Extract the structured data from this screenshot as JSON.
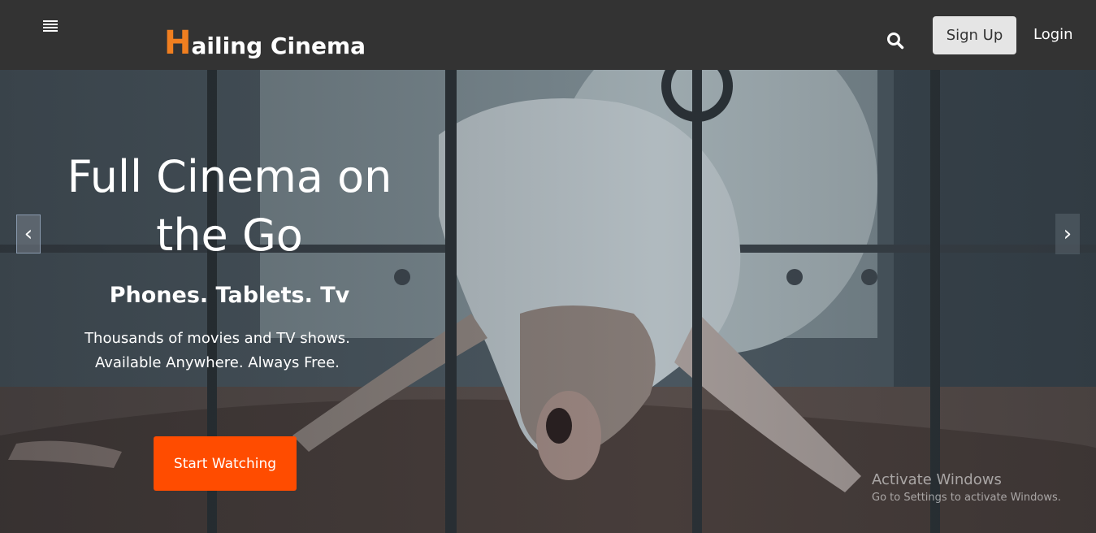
{
  "header": {
    "brand_initial": "H",
    "brand_rest": "ailing Cinema",
    "brand_accent_color": "#f07f20",
    "menu_icon": "hamburger-menu-icon",
    "search_icon": "search-icon",
    "signup_label": "Sign Up",
    "login_label": "Login"
  },
  "hero": {
    "title": "Full Cinema on the Go",
    "subtitle": "Phones. Tablets. Tv",
    "description_line1": "Thousands of movies and TV shows.",
    "description_line2": "Available Anywhere. Always Free.",
    "cta_label": "Start Watching",
    "cta_color": "#ff4c00",
    "prev_arrow": "‹",
    "next_arrow": "›"
  },
  "watermark": {
    "title": "Activate Windows",
    "subtitle": "Go to Settings to activate Windows."
  }
}
